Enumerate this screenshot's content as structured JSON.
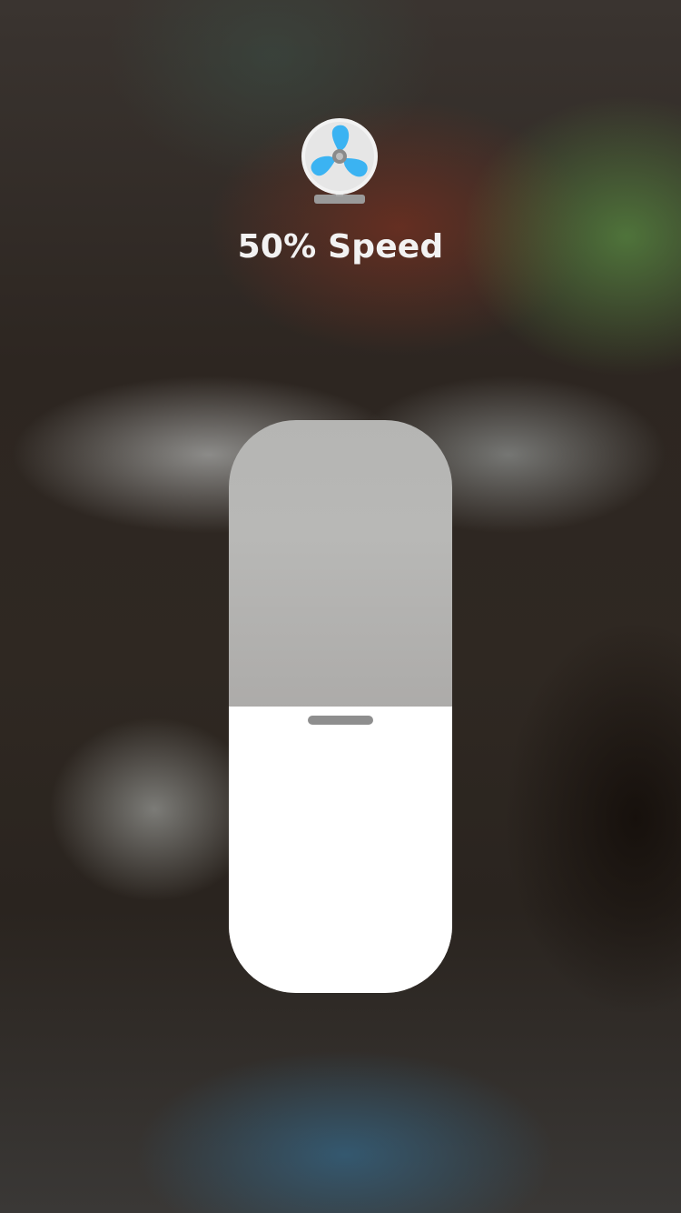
{
  "control": {
    "title": "50% Speed",
    "level_percent": 50,
    "icon": "fan-icon"
  },
  "colors": {
    "fan_blade": "#3BB3F2",
    "fan_face": "#F2F2F2",
    "fan_stand": "#9A9A9A",
    "slider_fill": "#FFFFFF",
    "slider_track": "#B5B5B3"
  }
}
